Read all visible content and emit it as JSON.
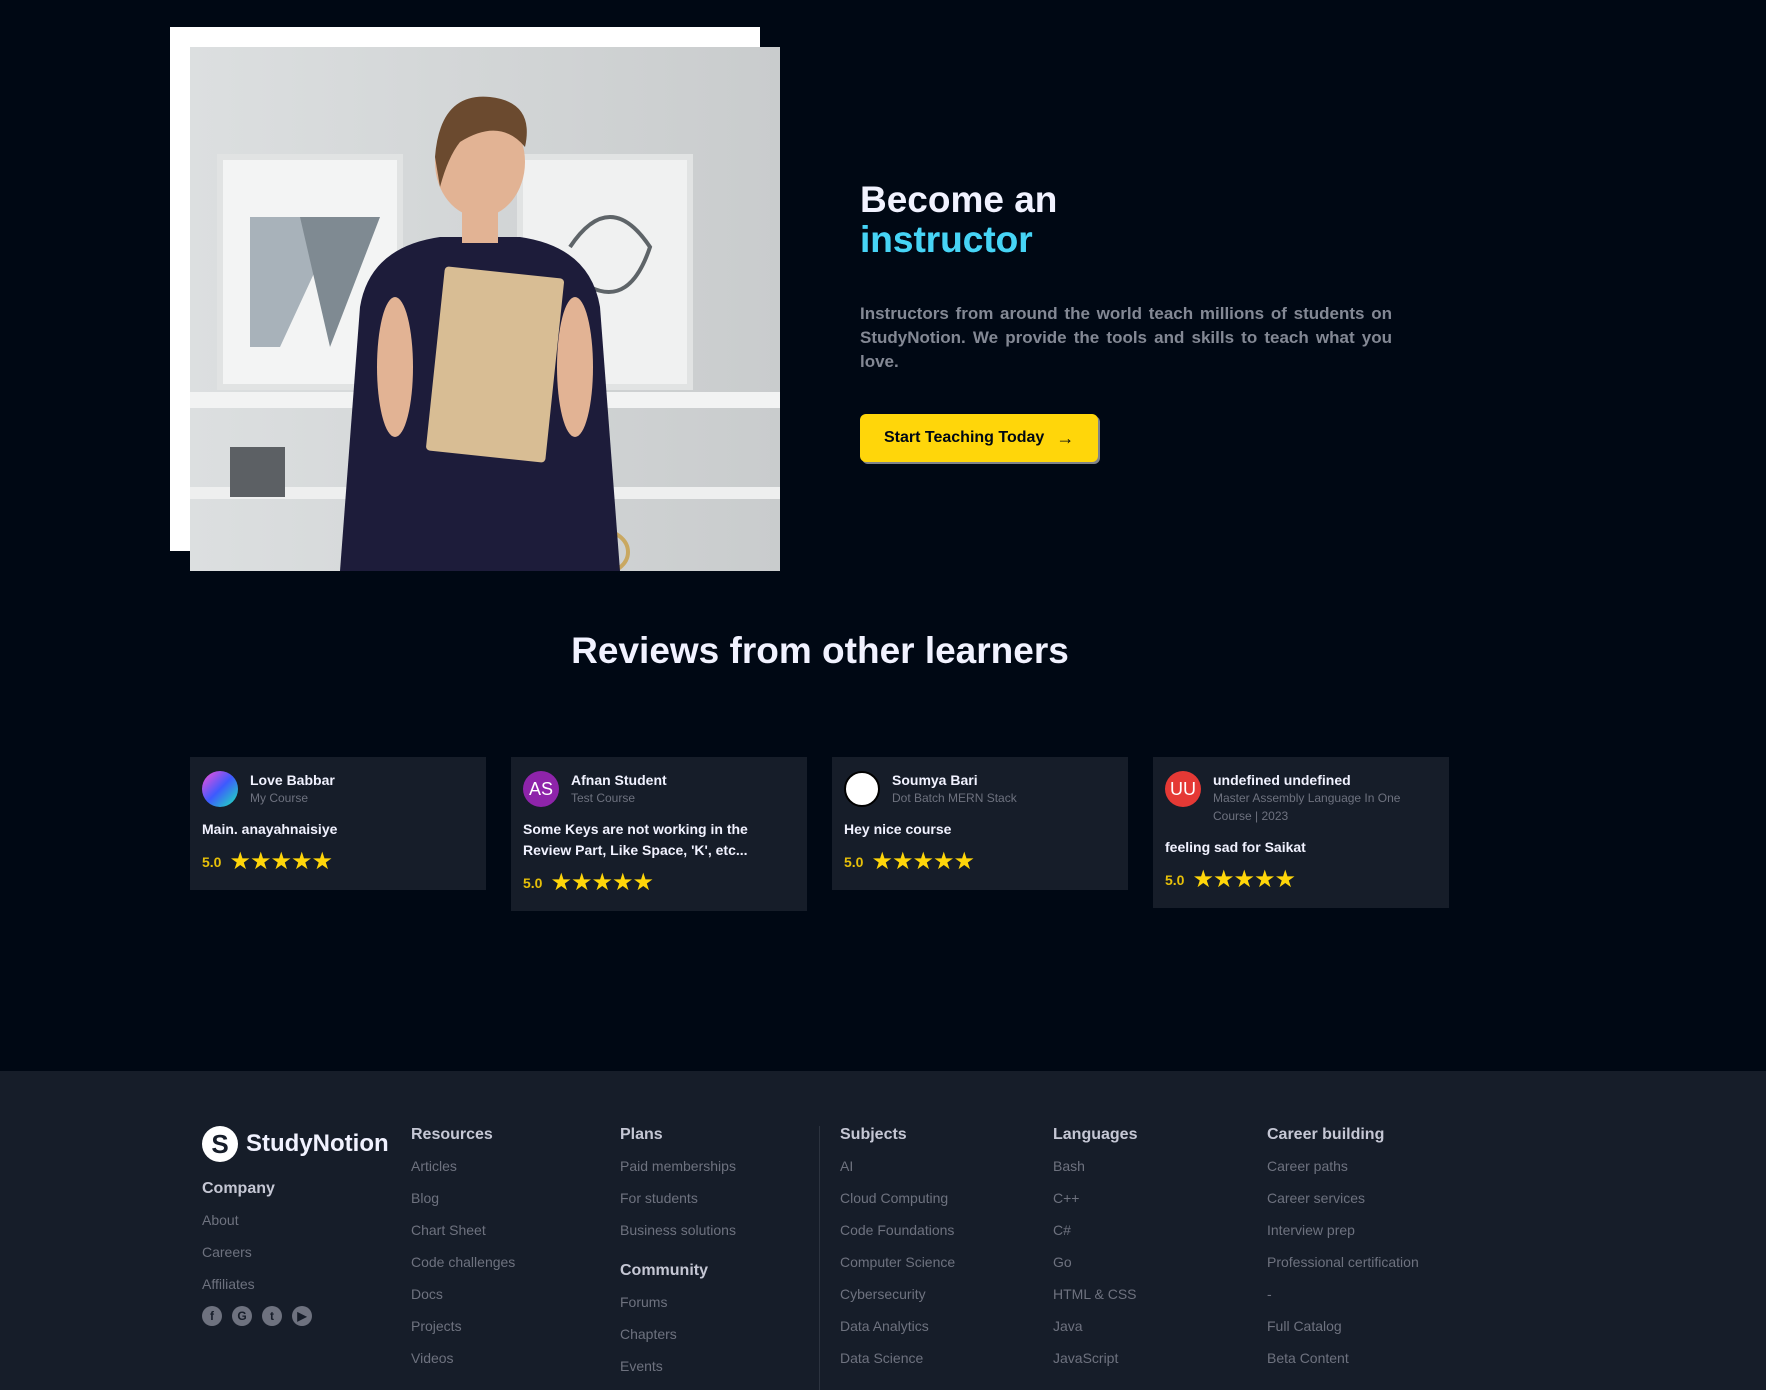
{
  "instructor": {
    "heading_line1": "Become an",
    "heading_line2": "instructor",
    "description": "Instructors from around the world teach millions of students on StudyNotion. We provide the tools and skills to teach what you love.",
    "cta_label": "Start Teaching Today",
    "cta_icon": "arrow-right-icon"
  },
  "reviews": {
    "title": "Reviews from other learners",
    "items": [
      {
        "name": "Love Babbar",
        "course": "My Course",
        "text": "Main. anayahnaisiye",
        "rating": "5.0",
        "stars": "★★★★★",
        "avatar_initials": "",
        "avatar_color": "#4a2f6b"
      },
      {
        "name": "Afnan Student",
        "course": "Test Course",
        "text": "Some Keys are not working in the Review Part, Like Space, 'K', etc...",
        "rating": "5.0",
        "stars": "★★★★★",
        "avatar_initials": "AS",
        "avatar_color": "#8e24aa"
      },
      {
        "name": "Soumya Bari",
        "course": "Dot Batch MERN Stack",
        "text": "Hey nice course",
        "rating": "5.0",
        "stars": "★★★★★",
        "avatar_initials": "",
        "avatar_color": "#f1f2ff"
      },
      {
        "name": "undefined undefined",
        "course": "Master Assembly Language In One Course | 2023",
        "text": "feeling sad for Saikat",
        "rating": "5.0",
        "stars": "★★★★★",
        "avatar_initials": "UU",
        "avatar_color": "#e53935"
      }
    ]
  },
  "footer": {
    "logo_mark": "S",
    "logo_text": "StudyNotion",
    "company": {
      "heading": "Company",
      "links": [
        "About",
        "Careers",
        "Affiliates"
      ]
    },
    "socials": [
      {
        "icon": "facebook-icon",
        "glyph": "f"
      },
      {
        "icon": "google-icon",
        "glyph": "G"
      },
      {
        "icon": "twitter-icon",
        "glyph": "t"
      },
      {
        "icon": "youtube-icon",
        "glyph": "▶"
      }
    ],
    "resources": {
      "heading": "Resources",
      "links": [
        "Articles",
        "Blog",
        "Chart Sheet",
        "Code challenges",
        "Docs",
        "Projects",
        "Videos"
      ]
    },
    "plans": {
      "heading": "Plans",
      "links": [
        "Paid memberships",
        "For students",
        "Business solutions"
      ]
    },
    "community": {
      "heading": "Community",
      "links": [
        "Forums",
        "Chapters",
        "Events"
      ]
    },
    "subjects": {
      "heading": "Subjects",
      "links": [
        "AI",
        "Cloud Computing",
        "Code Foundations",
        "Computer Science",
        "Cybersecurity",
        "Data Analytics",
        "Data Science"
      ]
    },
    "languages": {
      "heading": "Languages",
      "links": [
        "Bash",
        "C++",
        "C#",
        "Go",
        "HTML & CSS",
        "Java",
        "JavaScript"
      ]
    },
    "career": {
      "heading": "Career building",
      "links": [
        "Career paths",
        "Career services",
        "Interview prep",
        "Professional certification",
        "-",
        "Full Catalog",
        "Beta Content"
      ]
    }
  },
  "colors": {
    "accent_yellow": "#FFD60A",
    "gradient_blue": "#47d4f5",
    "bg": "#000814",
    "card": "#161D29"
  }
}
